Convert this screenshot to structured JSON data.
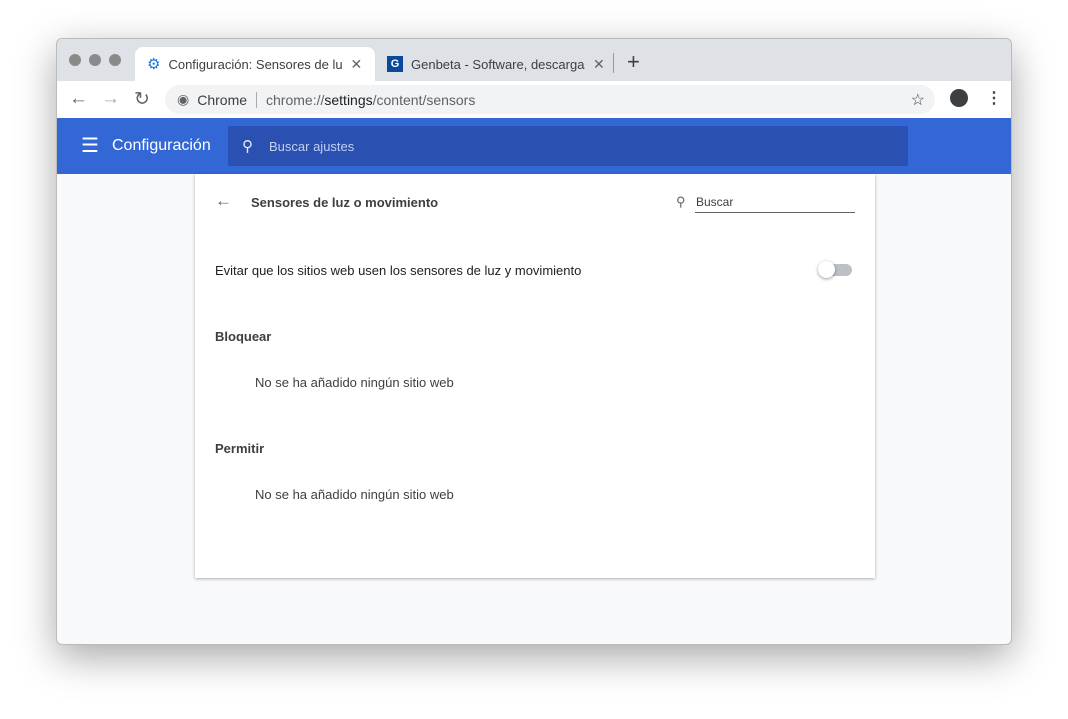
{
  "tabs": [
    {
      "title": "Configuración: Sensores de luz",
      "icon": "gear-icon"
    },
    {
      "title": "Genbeta - Software, descargas",
      "icon": "genbeta-logo-icon"
    }
  ],
  "omnibox": {
    "origin": "Chrome",
    "url_prefix": "chrome://",
    "url_host": "settings",
    "url_path": "/content/sensors"
  },
  "header": {
    "title": "Configuración",
    "search_placeholder": "Buscar ajustes"
  },
  "page": {
    "title": "Sensores de luz o movimiento",
    "search_placeholder": "Buscar",
    "toggle_label": "Evitar que los sitios web usen los sensores de luz y movimiento",
    "toggle_on": false,
    "block_heading": "Bloquear",
    "block_empty": "No se ha añadido ningún sitio web",
    "allow_heading": "Permitir",
    "allow_empty": "No se ha añadido ningún sitio web"
  },
  "colors": {
    "accent": "#3367d6"
  }
}
